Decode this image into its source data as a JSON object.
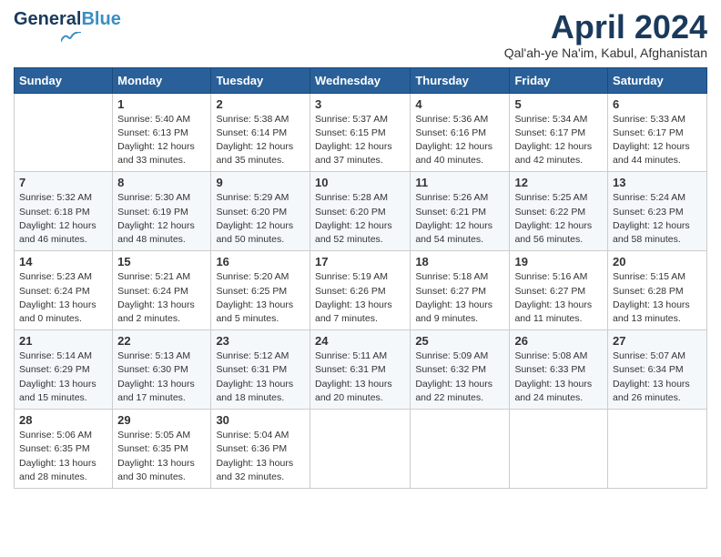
{
  "header": {
    "logo_general": "General",
    "logo_blue": "Blue",
    "month_title": "April 2024",
    "subtitle": "Qal'ah-ye Na'im, Kabul, Afghanistan"
  },
  "weekdays": [
    "Sunday",
    "Monday",
    "Tuesday",
    "Wednesday",
    "Thursday",
    "Friday",
    "Saturday"
  ],
  "weeks": [
    [
      {
        "day": "",
        "sunrise": "",
        "sunset": "",
        "daylight": ""
      },
      {
        "day": "1",
        "sunrise": "Sunrise: 5:40 AM",
        "sunset": "Sunset: 6:13 PM",
        "daylight": "Daylight: 12 hours and 33 minutes."
      },
      {
        "day": "2",
        "sunrise": "Sunrise: 5:38 AM",
        "sunset": "Sunset: 6:14 PM",
        "daylight": "Daylight: 12 hours and 35 minutes."
      },
      {
        "day": "3",
        "sunrise": "Sunrise: 5:37 AM",
        "sunset": "Sunset: 6:15 PM",
        "daylight": "Daylight: 12 hours and 37 minutes."
      },
      {
        "day": "4",
        "sunrise": "Sunrise: 5:36 AM",
        "sunset": "Sunset: 6:16 PM",
        "daylight": "Daylight: 12 hours and 40 minutes."
      },
      {
        "day": "5",
        "sunrise": "Sunrise: 5:34 AM",
        "sunset": "Sunset: 6:17 PM",
        "daylight": "Daylight: 12 hours and 42 minutes."
      },
      {
        "day": "6",
        "sunrise": "Sunrise: 5:33 AM",
        "sunset": "Sunset: 6:17 PM",
        "daylight": "Daylight: 12 hours and 44 minutes."
      }
    ],
    [
      {
        "day": "7",
        "sunrise": "Sunrise: 5:32 AM",
        "sunset": "Sunset: 6:18 PM",
        "daylight": "Daylight: 12 hours and 46 minutes."
      },
      {
        "day": "8",
        "sunrise": "Sunrise: 5:30 AM",
        "sunset": "Sunset: 6:19 PM",
        "daylight": "Daylight: 12 hours and 48 minutes."
      },
      {
        "day": "9",
        "sunrise": "Sunrise: 5:29 AM",
        "sunset": "Sunset: 6:20 PM",
        "daylight": "Daylight: 12 hours and 50 minutes."
      },
      {
        "day": "10",
        "sunrise": "Sunrise: 5:28 AM",
        "sunset": "Sunset: 6:20 PM",
        "daylight": "Daylight: 12 hours and 52 minutes."
      },
      {
        "day": "11",
        "sunrise": "Sunrise: 5:26 AM",
        "sunset": "Sunset: 6:21 PM",
        "daylight": "Daylight: 12 hours and 54 minutes."
      },
      {
        "day": "12",
        "sunrise": "Sunrise: 5:25 AM",
        "sunset": "Sunset: 6:22 PM",
        "daylight": "Daylight: 12 hours and 56 minutes."
      },
      {
        "day": "13",
        "sunrise": "Sunrise: 5:24 AM",
        "sunset": "Sunset: 6:23 PM",
        "daylight": "Daylight: 12 hours and 58 minutes."
      }
    ],
    [
      {
        "day": "14",
        "sunrise": "Sunrise: 5:23 AM",
        "sunset": "Sunset: 6:24 PM",
        "daylight": "Daylight: 13 hours and 0 minutes."
      },
      {
        "day": "15",
        "sunrise": "Sunrise: 5:21 AM",
        "sunset": "Sunset: 6:24 PM",
        "daylight": "Daylight: 13 hours and 2 minutes."
      },
      {
        "day": "16",
        "sunrise": "Sunrise: 5:20 AM",
        "sunset": "Sunset: 6:25 PM",
        "daylight": "Daylight: 13 hours and 5 minutes."
      },
      {
        "day": "17",
        "sunrise": "Sunrise: 5:19 AM",
        "sunset": "Sunset: 6:26 PM",
        "daylight": "Daylight: 13 hours and 7 minutes."
      },
      {
        "day": "18",
        "sunrise": "Sunrise: 5:18 AM",
        "sunset": "Sunset: 6:27 PM",
        "daylight": "Daylight: 13 hours and 9 minutes."
      },
      {
        "day": "19",
        "sunrise": "Sunrise: 5:16 AM",
        "sunset": "Sunset: 6:27 PM",
        "daylight": "Daylight: 13 hours and 11 minutes."
      },
      {
        "day": "20",
        "sunrise": "Sunrise: 5:15 AM",
        "sunset": "Sunset: 6:28 PM",
        "daylight": "Daylight: 13 hours and 13 minutes."
      }
    ],
    [
      {
        "day": "21",
        "sunrise": "Sunrise: 5:14 AM",
        "sunset": "Sunset: 6:29 PM",
        "daylight": "Daylight: 13 hours and 15 minutes."
      },
      {
        "day": "22",
        "sunrise": "Sunrise: 5:13 AM",
        "sunset": "Sunset: 6:30 PM",
        "daylight": "Daylight: 13 hours and 17 minutes."
      },
      {
        "day": "23",
        "sunrise": "Sunrise: 5:12 AM",
        "sunset": "Sunset: 6:31 PM",
        "daylight": "Daylight: 13 hours and 18 minutes."
      },
      {
        "day": "24",
        "sunrise": "Sunrise: 5:11 AM",
        "sunset": "Sunset: 6:31 PM",
        "daylight": "Daylight: 13 hours and 20 minutes."
      },
      {
        "day": "25",
        "sunrise": "Sunrise: 5:09 AM",
        "sunset": "Sunset: 6:32 PM",
        "daylight": "Daylight: 13 hours and 22 minutes."
      },
      {
        "day": "26",
        "sunrise": "Sunrise: 5:08 AM",
        "sunset": "Sunset: 6:33 PM",
        "daylight": "Daylight: 13 hours and 24 minutes."
      },
      {
        "day": "27",
        "sunrise": "Sunrise: 5:07 AM",
        "sunset": "Sunset: 6:34 PM",
        "daylight": "Daylight: 13 hours and 26 minutes."
      }
    ],
    [
      {
        "day": "28",
        "sunrise": "Sunrise: 5:06 AM",
        "sunset": "Sunset: 6:35 PM",
        "daylight": "Daylight: 13 hours and 28 minutes."
      },
      {
        "day": "29",
        "sunrise": "Sunrise: 5:05 AM",
        "sunset": "Sunset: 6:35 PM",
        "daylight": "Daylight: 13 hours and 30 minutes."
      },
      {
        "day": "30",
        "sunrise": "Sunrise: 5:04 AM",
        "sunset": "Sunset: 6:36 PM",
        "daylight": "Daylight: 13 hours and 32 minutes."
      },
      {
        "day": "",
        "sunrise": "",
        "sunset": "",
        "daylight": ""
      },
      {
        "day": "",
        "sunrise": "",
        "sunset": "",
        "daylight": ""
      },
      {
        "day": "",
        "sunrise": "",
        "sunset": "",
        "daylight": ""
      },
      {
        "day": "",
        "sunrise": "",
        "sunset": "",
        "daylight": ""
      }
    ]
  ]
}
